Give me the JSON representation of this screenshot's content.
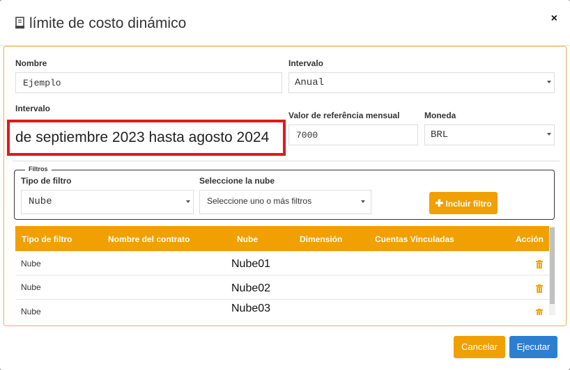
{
  "modal": {
    "title": "límite de costo dinámico",
    "close_label": "×"
  },
  "form": {
    "nombre_label": "Nombre",
    "nombre_value": "Ejemplo",
    "intervalo_label": "Intervalo",
    "intervalo_value": "Anual",
    "intervalo2_label": "Intervalo",
    "intervalo2_value": "de septiembre 2023 hasta agosto 2024",
    "valor_label": "Valor de referência mensual",
    "valor_value": "7000",
    "moneda_label": "Moneda",
    "moneda_value": "BRL"
  },
  "filters": {
    "legend": "Filtros",
    "tipo_label": "Tipo de filtro",
    "tipo_value": "Nube",
    "nube_label": "Seleccione la nube",
    "nube_placeholder": "Seleccione uno o más filtros",
    "include_button": "Incluir filtro",
    "include_icon": "plus-icon"
  },
  "table": {
    "headers": [
      "Tipo de filtro",
      "Nombre del contrato",
      "Nube",
      "Dimensión",
      "Cuentas Vinculadas",
      "Acción"
    ],
    "rows": [
      {
        "tipo": "Nube",
        "nube": "Nube01"
      },
      {
        "tipo": "Nube",
        "nube": "Nube02"
      },
      {
        "tipo": "Nube",
        "nube": "Nube03"
      }
    ],
    "header_color": "#f0a000",
    "action_icon": "trash-icon"
  },
  "footer": {
    "cancel_label": "Cancelar",
    "execute_label": "Ejecutar",
    "cancel_color": "#f0a000",
    "execute_color": "#2c7fd0"
  }
}
